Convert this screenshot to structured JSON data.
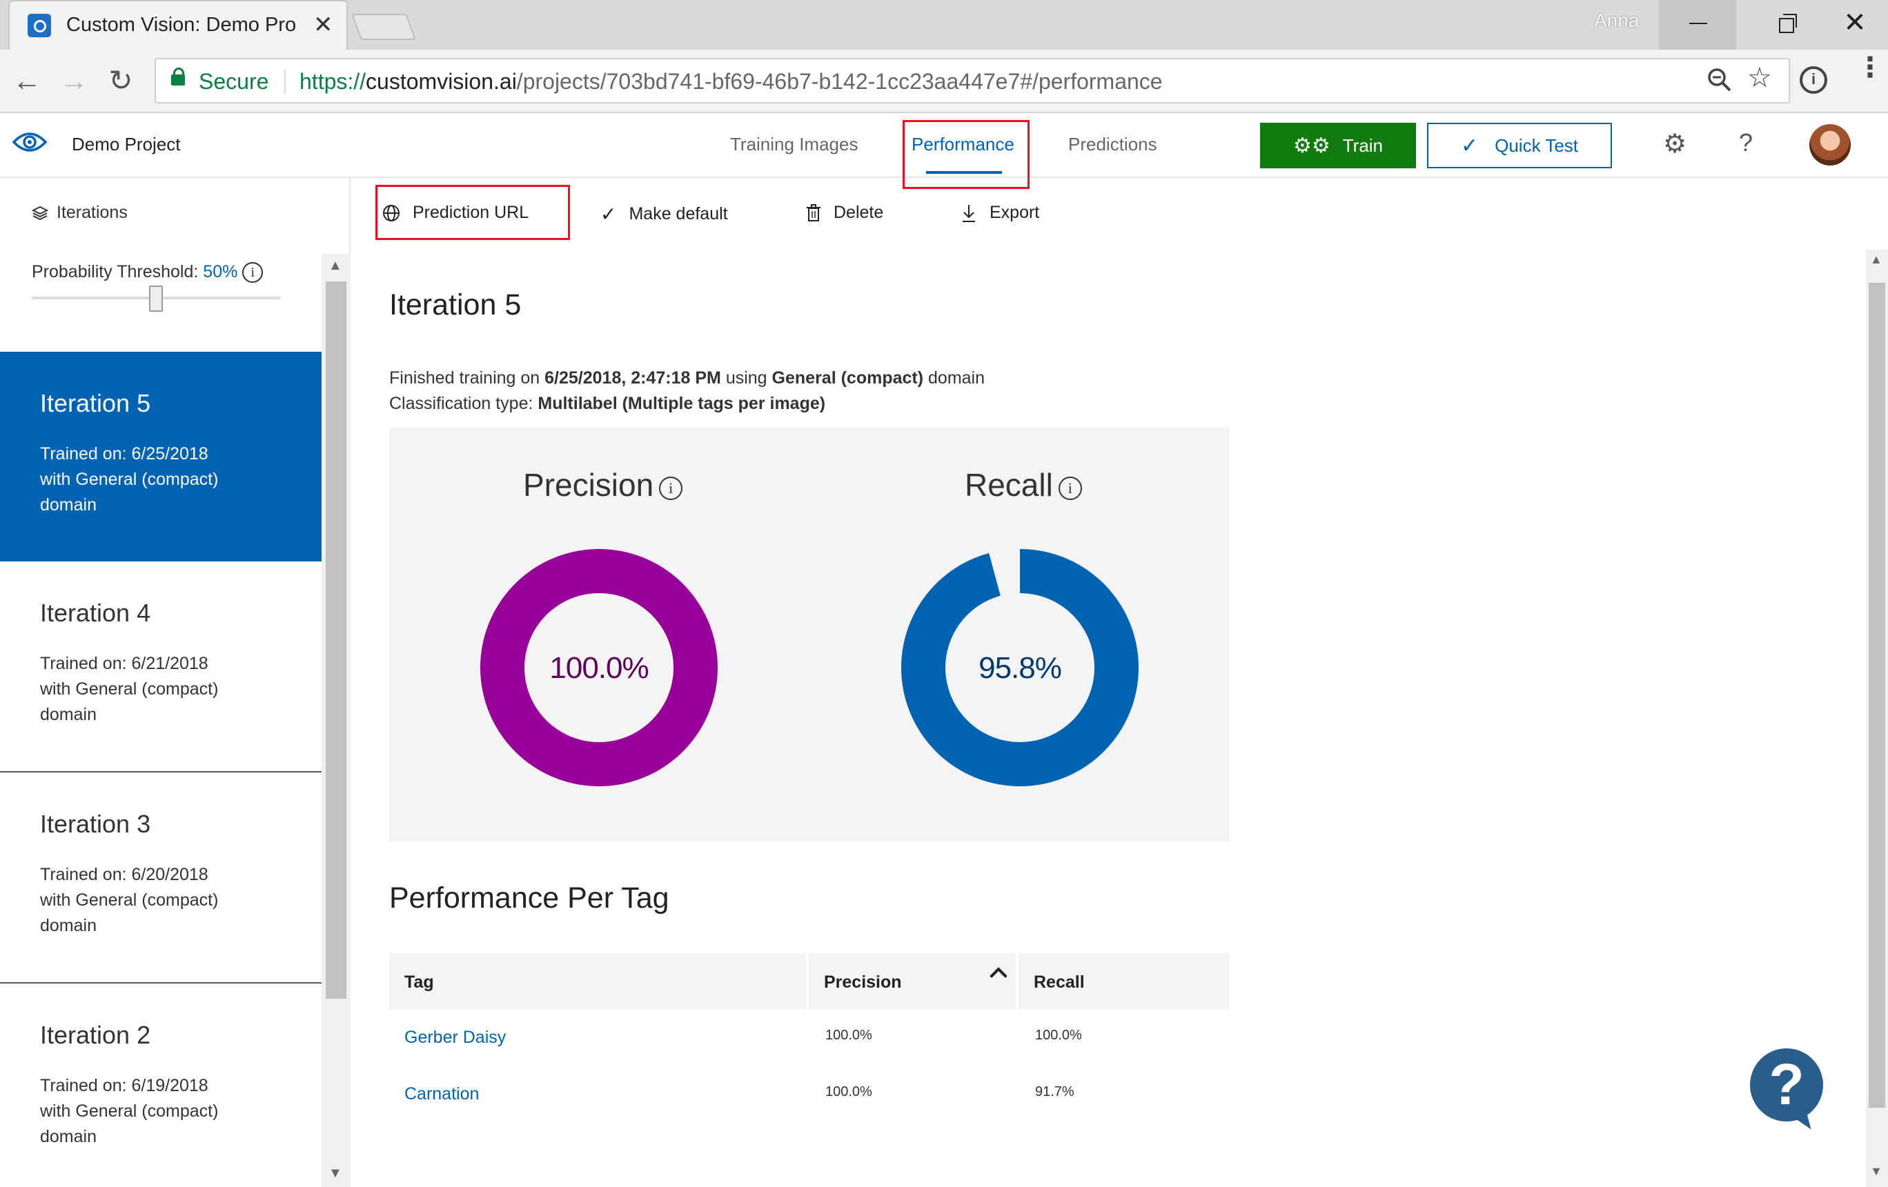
{
  "browser": {
    "tab_title": "Custom Vision: Demo Pro",
    "user_name": "Anna",
    "secure_label": "Secure",
    "url_scheme": "https://",
    "url_host": "customvision.ai",
    "url_path": "/projects/703bd741-bf69-46b7-b142-1cc23aa447e7#/performance"
  },
  "header": {
    "project_name": "Demo Project",
    "tabs": [
      {
        "label": "Training Images"
      },
      {
        "label": "Performance",
        "active": true
      },
      {
        "label": "Predictions"
      }
    ],
    "train_label": "Train",
    "quick_test_label": "Quick Test",
    "colors": {
      "accent": "#0063b1",
      "train": "#107c10",
      "highlight": "#e81123"
    }
  },
  "sidebar": {
    "iterations_label": "Iterations",
    "threshold_label": "Probability Threshold:",
    "threshold_value": "50%",
    "threshold_fraction": 0.5,
    "items": [
      {
        "name": "Iteration 5",
        "trained": "Trained on: 6/25/2018",
        "domain_line": "with General (compact)",
        "domain_word": "domain",
        "selected": true
      },
      {
        "name": "Iteration 4",
        "trained": "Trained on: 6/21/2018",
        "domain_line": "with General (compact)",
        "domain_word": "domain"
      },
      {
        "name": "Iteration 3",
        "trained": "Trained on: 6/20/2018",
        "domain_line": "with General (compact)",
        "domain_word": "domain"
      },
      {
        "name": "Iteration 2",
        "trained": "Trained on: 6/19/2018",
        "domain_line": "with General (compact)",
        "domain_word": "domain"
      }
    ]
  },
  "commands": {
    "prediction_url": "Prediction URL",
    "make_default": "Make default",
    "delete": "Delete",
    "export": "Export"
  },
  "iteration": {
    "title": "Iteration 5",
    "finished_prefix": "Finished training on ",
    "finished_date": "6/25/2018, 2:47:18 PM",
    "using": " using ",
    "domain": "General (compact)",
    "domain_suffix": " domain",
    "classification_prefix": "Classification type: ",
    "classification_type": "Multilabel (Multiple tags per image)"
  },
  "metrics": {
    "precision": {
      "label": "Precision",
      "value_text": "100.0%",
      "value": 100.0,
      "color": "#990099",
      "text_color": "#5c005c"
    },
    "recall": {
      "label": "Recall",
      "value_text": "95.8%",
      "value": 95.8,
      "color": "#0063b1",
      "text_color": "#003a6b"
    }
  },
  "per_tag": {
    "title": "Performance Per Tag",
    "columns": [
      "Tag",
      "Precision",
      "Recall"
    ],
    "rows": [
      {
        "tag": "Gerber Daisy",
        "precision": "100.0%",
        "recall": "100.0%"
      },
      {
        "tag": "Carnation",
        "precision": "100.0%",
        "recall": "91.7%"
      }
    ]
  }
}
